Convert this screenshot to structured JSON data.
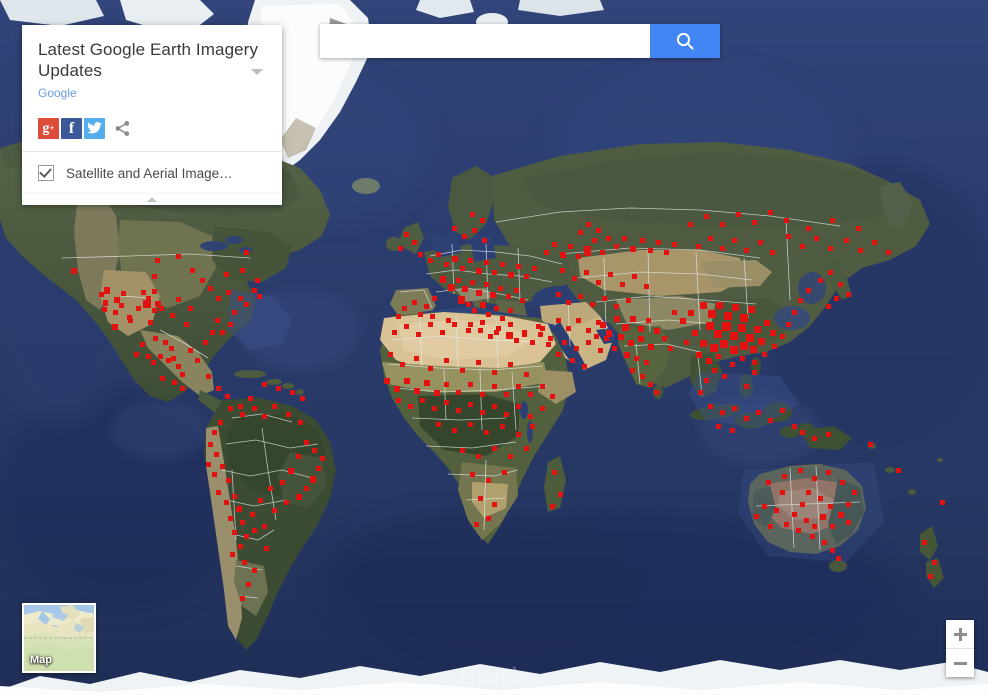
{
  "search": {
    "value": "",
    "placeholder": "",
    "button_icon": "search-icon",
    "button_label": ""
  },
  "info_card": {
    "title": "Latest Google Earth Imagery Updates",
    "author": "Google",
    "expand_icon": "chevron-down-icon",
    "share_buttons": [
      {
        "name": "google-plus",
        "glyph": "g+",
        "color": "#dd4b39"
      },
      {
        "name": "facebook",
        "glyph": "f",
        "color": "#3b5998"
      },
      {
        "name": "twitter",
        "glyph": "t",
        "color": "#55acee"
      },
      {
        "name": "share",
        "glyph": "share-icon",
        "color": "#8a8a8a"
      }
    ],
    "layer": {
      "label": "Satellite and Aerial Image…",
      "checked": true
    },
    "collapse_icon": "chevron-up-icon"
  },
  "map_type_control": {
    "label": "Map",
    "icon": "map-thumbnail"
  },
  "zoom_controls": {
    "zoom_in_label": "+",
    "zoom_out_label": "−",
    "zoom_in_icon": "plus-icon",
    "zoom_out_icon": "minus-icon"
  },
  "attribution": {
    "watermark": "Google"
  },
  "map": {
    "type": "satellite",
    "marker_color": "#e41111",
    "ocean_color": "#2b3c6e",
    "deep_ocean_color": "#1e2e5c",
    "vegetation_color": "#44543a",
    "desert_color": "#d8c296",
    "ice_color": "#f2f4f6"
  }
}
